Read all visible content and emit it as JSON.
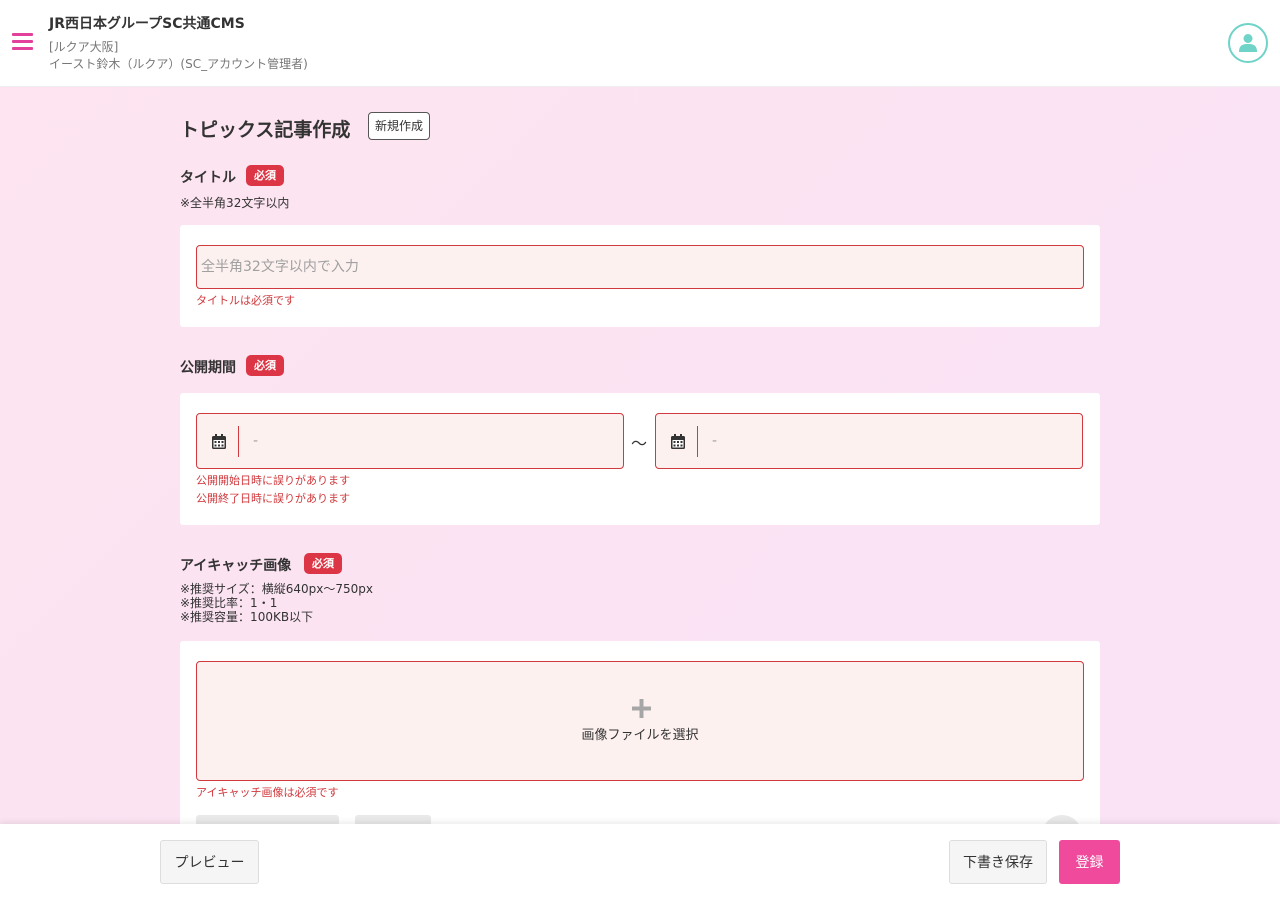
{
  "header": {
    "app_title": "JR西日本グループSC共通CMS",
    "site_name": "[ルクア大阪]",
    "user_name": "イースト鈴木（ルクア）(SC_アカウント管理者)",
    "menu_icon": "hamburger-menu-icon",
    "avatar_icon": "user-icon"
  },
  "page": {
    "title": "トピックス記事作成",
    "mode_badge": "新規作成"
  },
  "required_label": "必須",
  "title_section": {
    "label": "タイトル",
    "note": "※全半角32文字以内",
    "value": "",
    "placeholder": "全半角32文字以内で入力",
    "error": "タイトルは必須です"
  },
  "period_section": {
    "label": "公開期間",
    "start_placeholder": "-",
    "end_placeholder": "-",
    "separator": "〜",
    "error_start": "公開開始日時に誤りがあります",
    "error_end": "公開終了日時に誤りがあります",
    "calendar_icon": "calendar-icon"
  },
  "image_section": {
    "label": "アイキャッチ画像",
    "notes": [
      "※推奨サイズ：横縦640px〜750px",
      "※推奨比率：1・1",
      "※推奨容量：100KB以下"
    ],
    "upload_label": "画像ファイルを選択",
    "upload_icon": "plus-icon",
    "error": "アイキャッチ画像は必須です"
  },
  "footer": {
    "preview_label": "プレビュー",
    "draft_label": "下書き保存",
    "submit_label": "登録"
  },
  "colors": {
    "accent": "#ef4a9c",
    "error": "#d0393d",
    "required_badge": "#dc3545",
    "avatar_ring": "#6fd3c8"
  }
}
